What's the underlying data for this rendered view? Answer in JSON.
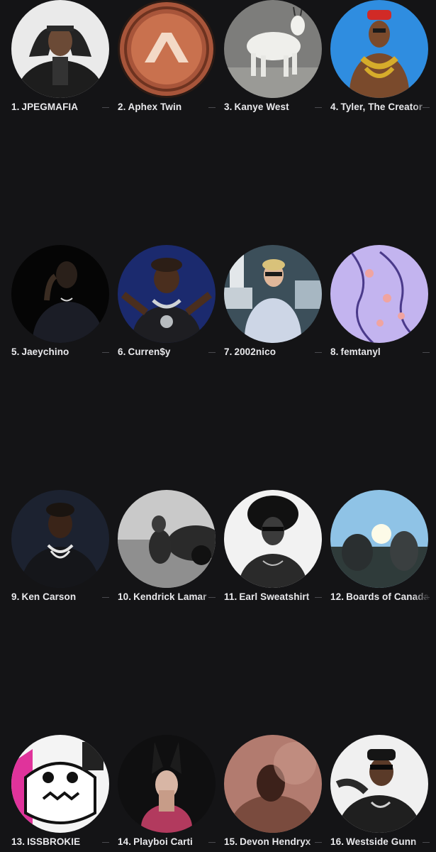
{
  "artists": [
    {
      "rank": "1.",
      "name": "JPEGMAFIA",
      "icon": "artist-photo"
    },
    {
      "rank": "2.",
      "name": "Aphex Twin",
      "icon": "aphex-logo"
    },
    {
      "rank": "3.",
      "name": "Kanye West",
      "icon": "artist-photo"
    },
    {
      "rank": "4.",
      "name": "Tyler, The Creator",
      "icon": "artist-photo"
    },
    {
      "rank": "5.",
      "name": "Jaeychino",
      "icon": "artist-photo"
    },
    {
      "rank": "6.",
      "name": "Curren$y",
      "icon": "artist-photo"
    },
    {
      "rank": "7.",
      "name": "2002nico",
      "icon": "artist-photo"
    },
    {
      "rank": "8.",
      "name": "femtanyl",
      "icon": "artist-art"
    },
    {
      "rank": "9.",
      "name": "Ken Carson",
      "icon": "artist-photo"
    },
    {
      "rank": "10.",
      "name": "Kendrick Lamar",
      "icon": "artist-photo"
    },
    {
      "rank": "11.",
      "name": "Earl Sweatshirt",
      "icon": "artist-photo"
    },
    {
      "rank": "12.",
      "name": "Boards of Canada",
      "icon": "artist-photo"
    },
    {
      "rank": "13.",
      "name": "ISSBROKIE",
      "icon": "artist-art"
    },
    {
      "rank": "14.",
      "name": "Playboi Carti",
      "icon": "artist-photo"
    },
    {
      "rank": "15.",
      "name": "Devon Hendryx",
      "icon": "artist-photo"
    },
    {
      "rank": "16.",
      "name": "Westside Gunn",
      "icon": "artist-photo"
    }
  ],
  "colors": {
    "background": "#141416",
    "label": "#e9e9ec",
    "separator": "#4a4a4f"
  }
}
